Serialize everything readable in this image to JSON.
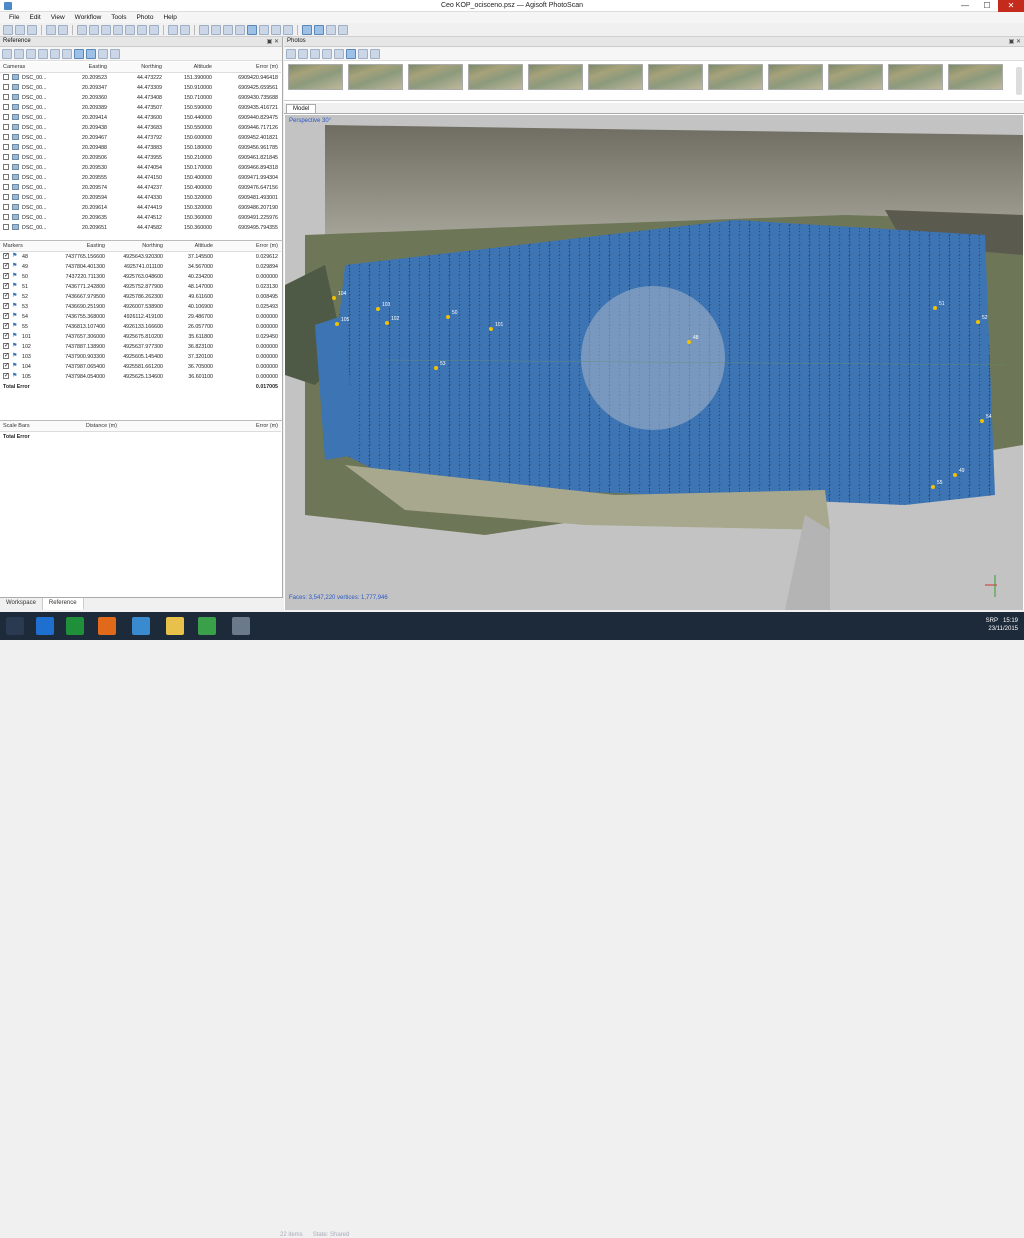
{
  "window": {
    "title": "Ceo KOP_ocisceno.psz — Agisoft PhotoScan",
    "min": "—",
    "max": "☐",
    "close": "✕"
  },
  "menu": [
    "File",
    "Edit",
    "View",
    "Workflow",
    "Tools",
    "Photo",
    "Help"
  ],
  "reference": {
    "title": "Reference",
    "cameras": {
      "headers": [
        "Cameras",
        "Easting",
        "Northing",
        "Altitude",
        "Error (m)"
      ],
      "rows": [
        [
          "DSC_00...",
          "20.209523",
          "44.473222",
          "151.390000",
          "6909420.946418"
        ],
        [
          "DSC_00...",
          "20.209347",
          "44.473309",
          "150.910000",
          "6909425.659561"
        ],
        [
          "DSC_00...",
          "20.209360",
          "44.473408",
          "150.710000",
          "6909430.735688"
        ],
        [
          "DSC_00...",
          "20.209389",
          "44.473507",
          "150.590000",
          "6909435.416721"
        ],
        [
          "DSC_00...",
          "20.209414",
          "44.473600",
          "150.440000",
          "6909440.829475"
        ],
        [
          "DSC_00...",
          "20.209438",
          "44.473683",
          "150.550000",
          "6909446.717126"
        ],
        [
          "DSC_00...",
          "20.209467",
          "44.473792",
          "150.600000",
          "6909452.401821"
        ],
        [
          "DSC_00...",
          "20.209488",
          "44.473883",
          "150.180000",
          "6909456.961785"
        ],
        [
          "DSC_00...",
          "20.209506",
          "44.473955",
          "150.210000",
          "6909461.821845"
        ],
        [
          "DSC_00...",
          "20.209530",
          "44.474054",
          "150.170000",
          "6909466.894318"
        ],
        [
          "DSC_00...",
          "20.209555",
          "44.474150",
          "150.400000",
          "6909471.994304"
        ],
        [
          "DSC_00...",
          "20.209574",
          "44.474237",
          "150.400000",
          "6909476.647156"
        ],
        [
          "DSC_00...",
          "20.209594",
          "44.474330",
          "150.320000",
          "6909481.493001"
        ],
        [
          "DSC_00...",
          "20.209614",
          "44.474419",
          "150.320000",
          "6909486.207190"
        ],
        [
          "DSC_00...",
          "20.209635",
          "44.474512",
          "150.360000",
          "6909491.225976"
        ],
        [
          "DSC_00...",
          "20.209651",
          "44.474582",
          "150.360000",
          "6909495.794355"
        ]
      ]
    },
    "markers": {
      "headers": [
        "Markers",
        "Easting",
        "Northing",
        "Altitude",
        "Error (m)"
      ],
      "rows": [
        [
          "48",
          "7437765.156600",
          "4925643.920300",
          "37.145500",
          "0.029612"
        ],
        [
          "49",
          "7437804.401300",
          "4925741.011100",
          "34.567000",
          "0.029894"
        ],
        [
          "50",
          "7437220.711300",
          "4925763.048600",
          "40.234200",
          "0.000000"
        ],
        [
          "51",
          "7436771.242800",
          "4925752.877900",
          "48.147000",
          "0.023130"
        ],
        [
          "52",
          "7436667.979500",
          "4925786.262300",
          "49.611600",
          "0.008495"
        ],
        [
          "53",
          "7436690.251900",
          "4926007.538900",
          "40.106900",
          "0.025493"
        ],
        [
          "54",
          "7436755.368000",
          "4926112.419100",
          "29.486700",
          "0.000000"
        ],
        [
          "55",
          "7436813.107400",
          "4926133.166600",
          "26.057700",
          "0.000000"
        ],
        [
          "101",
          "7437657.306000",
          "4925675.810200",
          "35.611800",
          "0.029450"
        ],
        [
          "102",
          "7437887.138900",
          "4925637.977300",
          "36.823100",
          "0.000000"
        ],
        [
          "103",
          "7437900.903300",
          "4925605.145400",
          "37.320100",
          "0.000000"
        ],
        [
          "104",
          "7437987.065400",
          "4925581.661200",
          "36.705000",
          "0.000000"
        ],
        [
          "105",
          "7437984.054000",
          "4925625.134600",
          "36.601100",
          "0.000000"
        ]
      ],
      "total_label": "Total Error",
      "total_value": "0.017005"
    },
    "scalebars": {
      "headers": [
        "Scale Bars",
        "Distance (m)",
        "Error (m)"
      ],
      "total_label": "Total Error"
    },
    "tabs": [
      "Workspace",
      "Reference"
    ]
  },
  "photos": {
    "title": "Photos"
  },
  "model": {
    "tab": "Model",
    "perspective": "Perspective 30°",
    "stats": "Faces: 3,547,220 vertices: 1,777,946",
    "markers": [
      "104",
      "103",
      "105",
      "102",
      "48",
      "101",
      "50",
      "53",
      "51",
      "52",
      "54",
      "55",
      "49"
    ]
  },
  "taskbar": {
    "status_items": "22 items",
    "state": "State: ",
    "shared": "Shared",
    "lang": "SRP",
    "time": "15:19",
    "date": "23/11/2015"
  }
}
